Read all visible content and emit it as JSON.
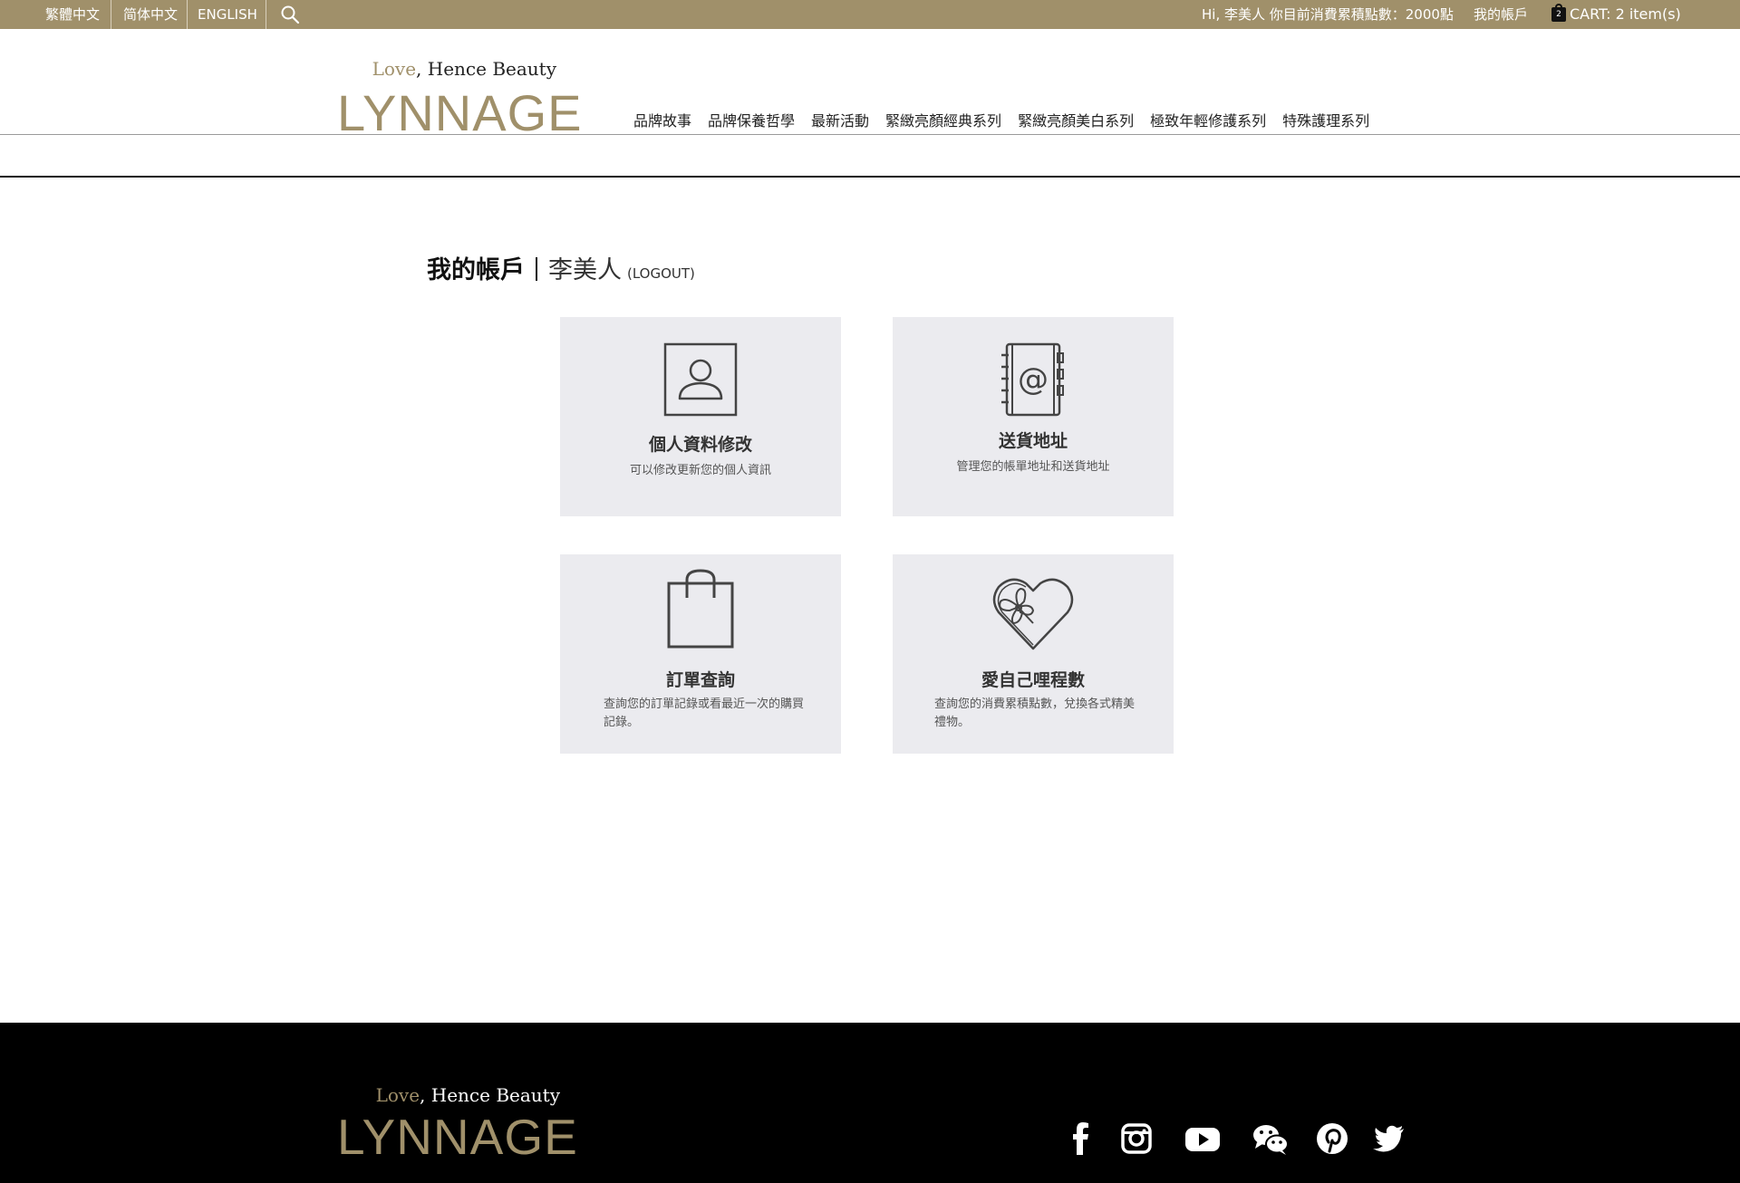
{
  "topbar": {
    "languages": [
      "繁體中文",
      "简体中文",
      "ENGLISH"
    ],
    "greeting": "Hi, 李美人 你目前消費累積點數：2000點",
    "my_account": "我的帳戶",
    "cart_label": "CART: 2 item(s)",
    "cart_count": "2"
  },
  "brand": {
    "tagline_love": "Love",
    "tagline_rest": ", Hence Beauty",
    "name": "LYNNAGE"
  },
  "nav": {
    "items": [
      "品牌故事",
      "品牌保養哲學",
      "最新活動",
      "緊緻亮顏經典系列",
      "緊緻亮顏美白系列",
      "極致年輕修護系列",
      "特殊護理系列"
    ]
  },
  "account": {
    "heading": "我的帳戶",
    "username": "李美人",
    "logout": "(LOGOUT)"
  },
  "cards": [
    {
      "title": "個人資料修改",
      "desc": "可以修改更新您的個人資訊",
      "icon": "user-profile-icon"
    },
    {
      "title": "送貨地址",
      "desc": "管理您的帳單地址和送貨地址",
      "icon": "address-book-icon"
    },
    {
      "title": "訂單查詢",
      "desc": "查詢您的訂單記錄或看最近一次的購買記錄。",
      "icon": "shopping-bag-icon"
    },
    {
      "title": "愛自己哩程數",
      "desc": "查詢您的消費累積點數，兌換各式精美禮物。",
      "icon": "gift-heart-icon"
    }
  ],
  "footer": {
    "social": [
      "facebook-icon",
      "instagram-icon",
      "youtube-icon",
      "wechat-icon",
      "pinterest-icon",
      "twitter-icon"
    ]
  },
  "colors": {
    "brand_gold": "#a0906a",
    "card_bg": "#ebebef",
    "footer_bg": "#000000"
  }
}
